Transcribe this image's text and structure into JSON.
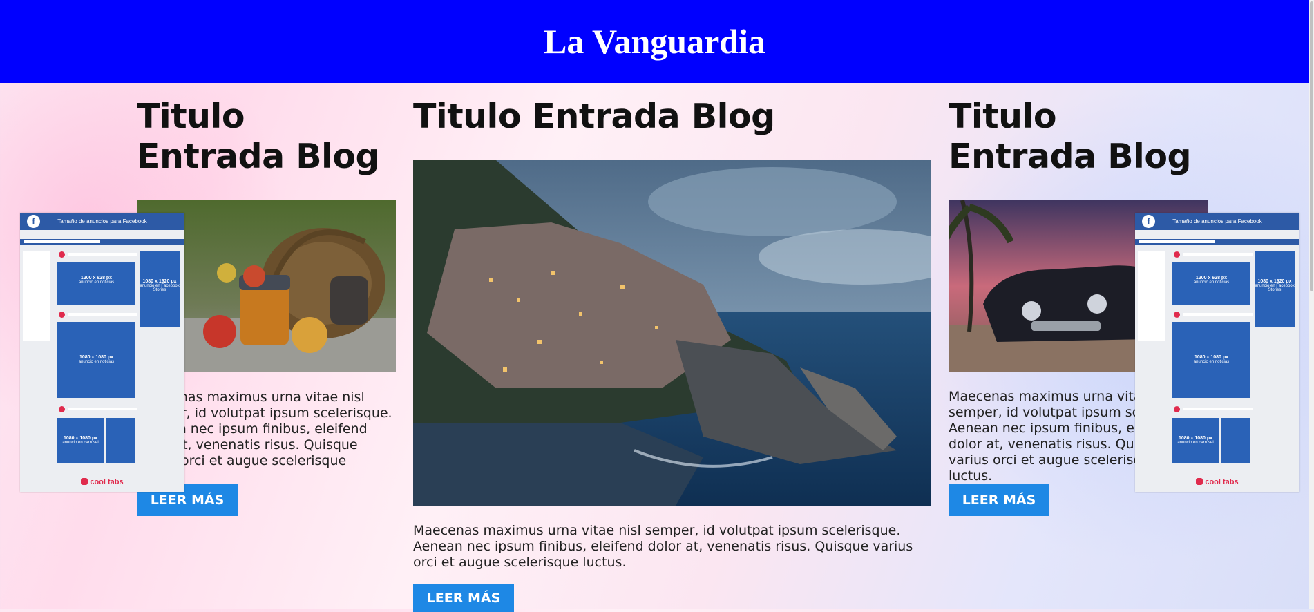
{
  "site": {
    "title": "La Vanguardia"
  },
  "posts": [
    {
      "title": "Titulo Entrada Blog",
      "excerpt": "Maecenas maximus urna vitae nisl semper, id volutpat ipsum scelerisque. Aenean nec ipsum finibus, eleifend dolor at, venenatis risus. Quisque varius orci et augue scelerisque luctus.",
      "button": "LEER MÁS",
      "image": "basket-apples-jar"
    },
    {
      "title": "Titulo Entrada Blog",
      "excerpt": "Maecenas maximus urna vitae nisl semper, id volutpat ipsum scelerisque. Aenean nec ipsum finibus, eleifend dolor at, venenatis risus. Quisque varius orci et augue scelerisque luctus.",
      "button": "LEER MÁS",
      "image": "coastal-village-night"
    },
    {
      "title": "Titulo Entrada Blog",
      "excerpt": "Maecenas maximus urna vitae nisl semper, id volutpat ipsum scelerisque. Aenean nec ipsum finibus, eleifend dolor at, venenatis risus. Quisque varius orci et augue scelerisque luctus.",
      "button": "LEER MÁS",
      "image": "classic-car-beach-sunset"
    }
  ],
  "ads": {
    "header": "Tamaño de anuncios para Facebook",
    "block1": "1200 x 628 px",
    "block1_sub": "anuncio en noticias",
    "block2": "1080 x 1920 px",
    "block2_sub": "anuncio en Facebook Stories",
    "block3": "1080 x 1080 px",
    "block3_sub": "anuncio en noticias",
    "block4": "1080 x 1080 px",
    "block4_sub": "anuncio en carrusel",
    "brand": "cool tabs"
  },
  "colors": {
    "header_bg": "#0000ff",
    "button_bg": "#1e88e5",
    "fb_blue": "#2a62b7",
    "brand_red": "#e02b4d"
  }
}
